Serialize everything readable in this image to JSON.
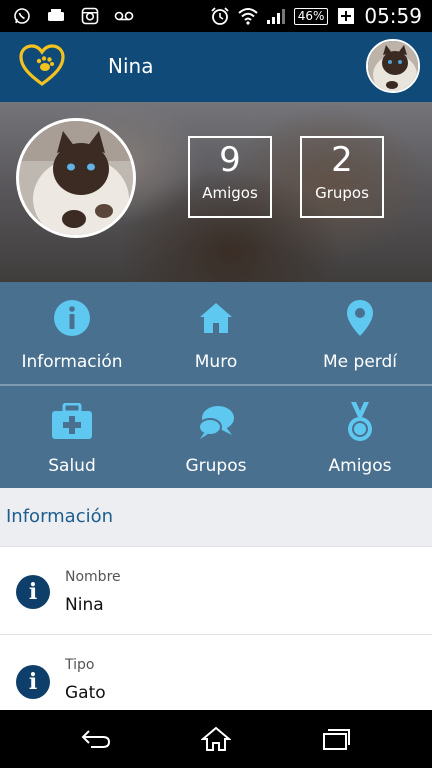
{
  "status_bar": {
    "left_icons": [
      "whatsapp-icon",
      "notification-icon",
      "instagram-icon",
      "voicemail-icon"
    ],
    "right_icons": [
      "alarm-icon",
      "wifi-icon",
      "signal-icon"
    ],
    "battery": "46%",
    "time": "05:59"
  },
  "app_bar": {
    "title": "Nina",
    "accent": "#f4c21f",
    "background": "#0f4a79"
  },
  "profile": {
    "stats": [
      {
        "value": "9",
        "label": "Amigos"
      },
      {
        "value": "2",
        "label": "Grupos"
      }
    ]
  },
  "menu": {
    "row1": [
      {
        "label": "Información",
        "icon": "info-icon"
      },
      {
        "label": "Muro",
        "icon": "home-icon"
      },
      {
        "label": "Me perdí",
        "icon": "location-pin-icon"
      }
    ],
    "row2": [
      {
        "label": "Salud",
        "icon": "first-aid-kit-icon"
      },
      {
        "label": "Grupos",
        "icon": "chat-bubbles-icon"
      },
      {
        "label": "Amigos",
        "icon": "medal-icon"
      }
    ],
    "icon_color": "#5ec8f0",
    "background": "#49708f"
  },
  "info_section": {
    "title": "Información",
    "fields": [
      {
        "label": "Nombre",
        "value": "Nina"
      },
      {
        "label": "Tipo",
        "value": "Gato"
      }
    ]
  },
  "nav_bar": {
    "buttons": [
      "back-icon",
      "home-icon",
      "recents-icon"
    ]
  }
}
